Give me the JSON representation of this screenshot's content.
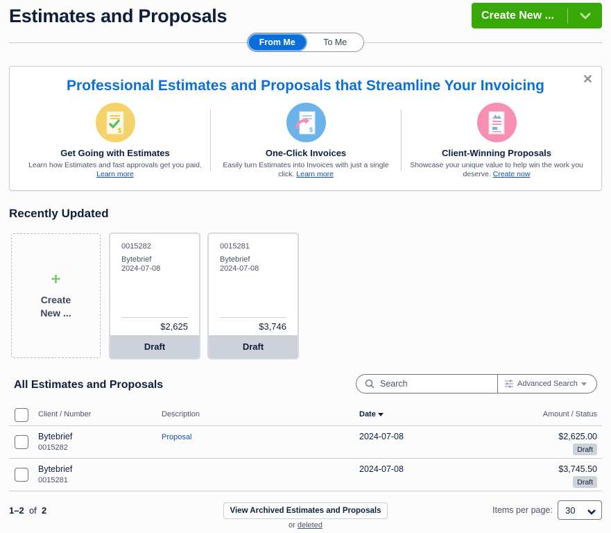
{
  "header": {
    "title": "Estimates and Proposals",
    "create_button_label": "Create New ...",
    "toggle": [
      {
        "label": "From Me",
        "active": true
      },
      {
        "label": "To Me",
        "active": false
      }
    ]
  },
  "banner": {
    "title": "Professional Estimates and Proposals that Streamline Your Invoicing",
    "close_icon": "close-icon",
    "features": [
      {
        "icon": "estimate-check-icon",
        "color": "#f5d36b",
        "title": "Get Going with Estimates",
        "desc": "Learn how Estimates and fast approvals get you paid.",
        "link": "Learn more"
      },
      {
        "icon": "invoice-arrow-icon",
        "color": "#6cb3ea",
        "title": "One-Click Invoices",
        "desc": "Easily turn Estimates into Invoices with just a single click.",
        "link": "Learn more"
      },
      {
        "icon": "proposal-document-icon",
        "color": "#f68fb3",
        "title": "Client-Winning Proposals",
        "desc": "Showcase your unique value to help win the work you deserve.",
        "link": "Create now"
      }
    ]
  },
  "recent": {
    "title": "Recently Updated",
    "create_card": {
      "line1": "Create",
      "line2": "New ..."
    },
    "cards": [
      {
        "number": "0015282",
        "client": "Bytebrief",
        "date": "2024-07-08",
        "amount": "$2,625",
        "status": "Draft"
      },
      {
        "number": "0015281",
        "client": "Bytebrief",
        "date": "2024-07-08",
        "amount": "$3,746",
        "status": "Draft"
      }
    ]
  },
  "list": {
    "title": "All Estimates and Proposals",
    "search_placeholder": "Search",
    "advanced_search_label": "Advanced Search",
    "columns": {
      "client": "Client / Number",
      "description": "Description",
      "date": "Date",
      "amount": "Amount / Status"
    },
    "sorted_by": "Date",
    "rows": [
      {
        "client": "Bytebrief",
        "number": "0015282",
        "description": "Proposal",
        "date": "2024-07-08",
        "amount": "$2,625.00",
        "status": "Draft"
      },
      {
        "client": "Bytebrief",
        "number": "0015281",
        "description": "",
        "date": "2024-07-08",
        "amount": "$3,745.50",
        "status": "Draft"
      }
    ]
  },
  "footer": {
    "range": "1–2",
    "of_label": "of",
    "total": "2",
    "archived_button": "View Archived Estimates and Proposals",
    "or_label": "or",
    "deleted_link": "deleted",
    "items_per_page_label": "Items per page:",
    "items_per_page": "30"
  }
}
